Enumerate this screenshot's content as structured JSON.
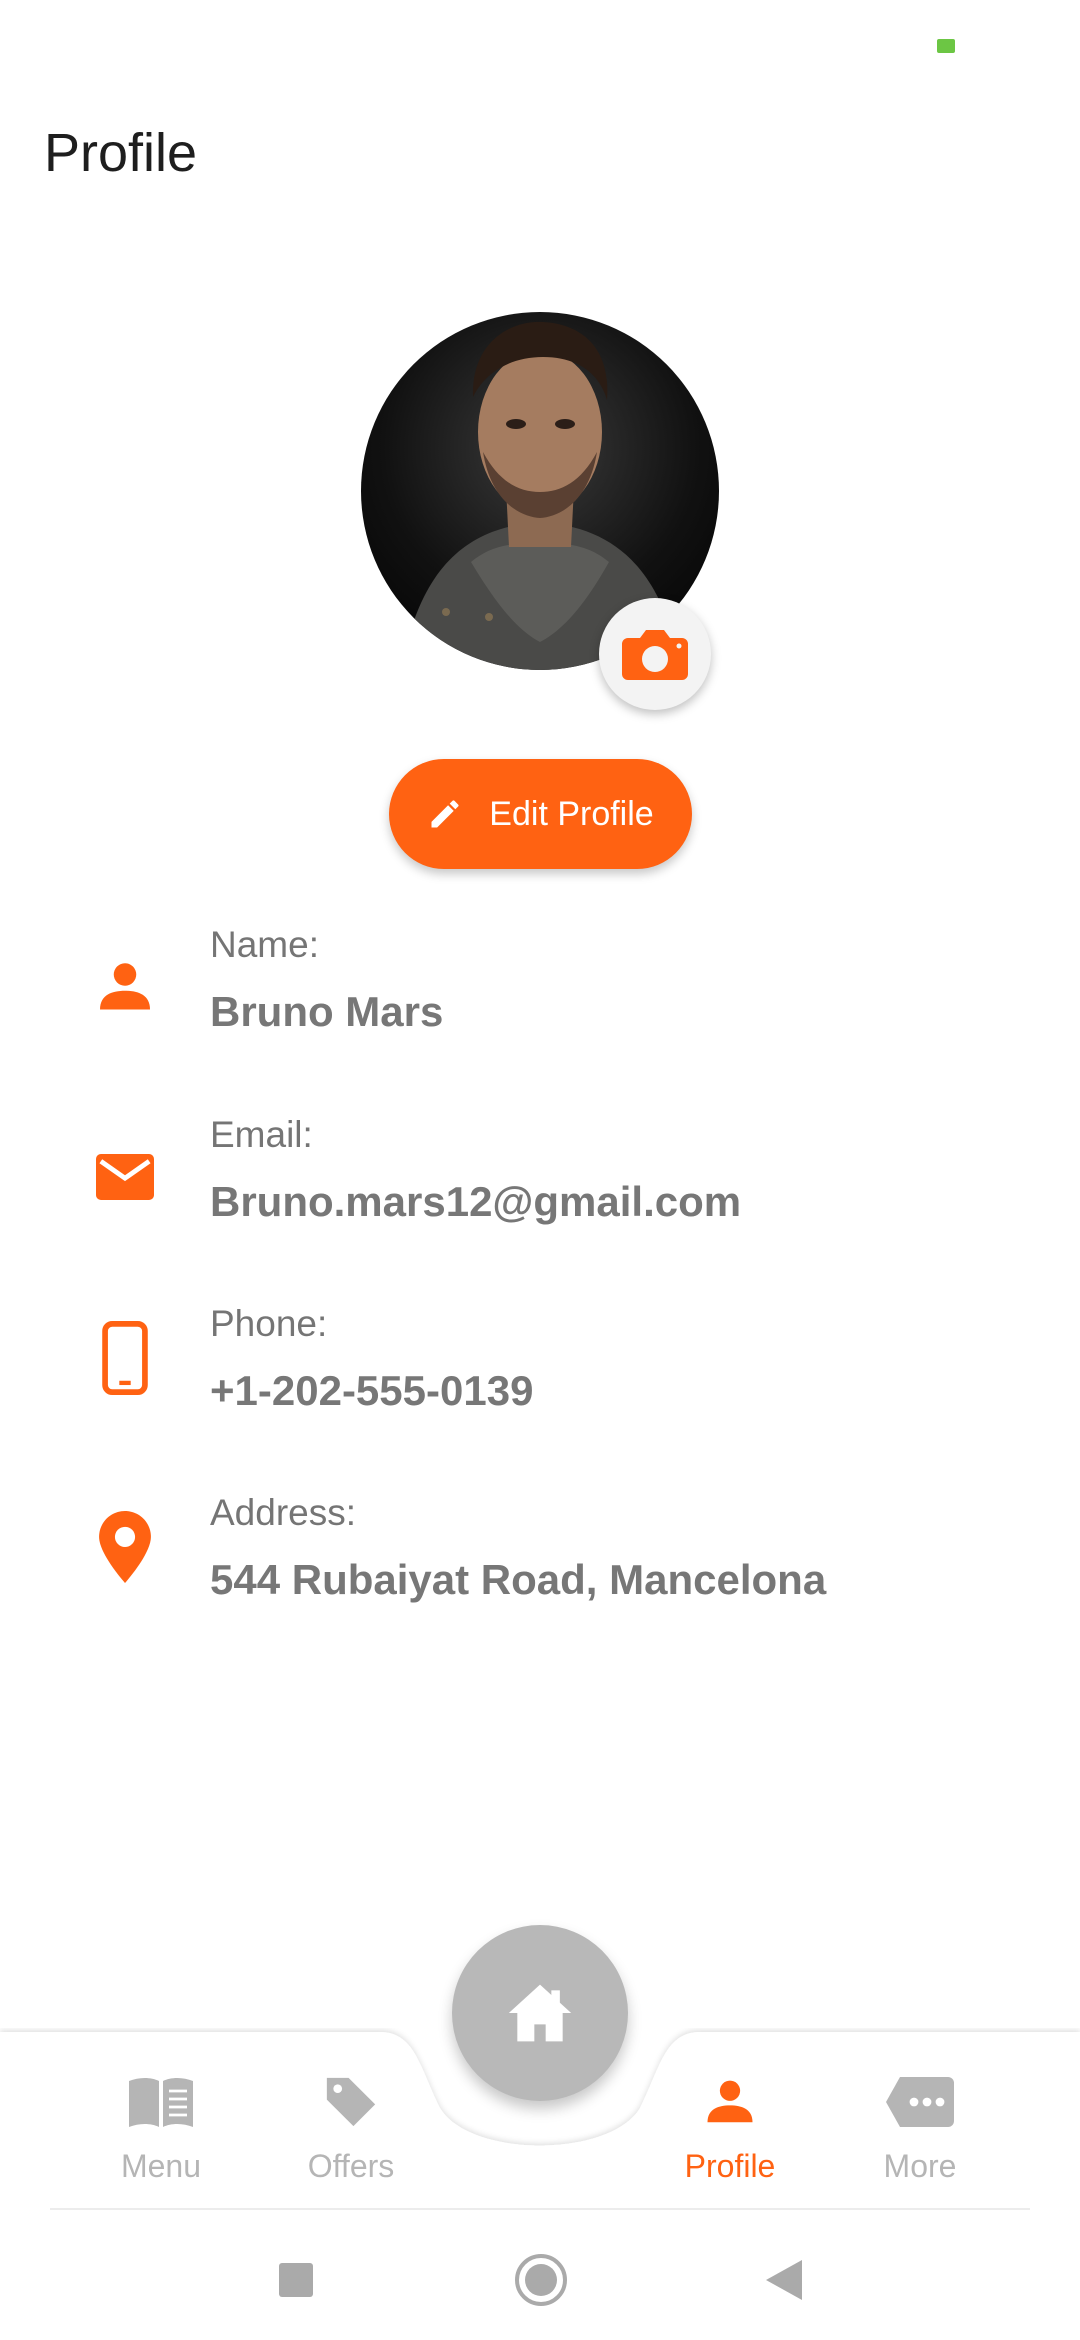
{
  "status_bar": {
    "battery_indicator": "4"
  },
  "page": {
    "title": "Profile"
  },
  "profile": {
    "avatar_alt": "profile photo",
    "edit_button": "Edit Profile"
  },
  "fields": [
    {
      "icon": "person-icon",
      "label": "Name:",
      "value": "Bruno Mars"
    },
    {
      "icon": "mail-icon",
      "label": "Email:",
      "value": "Bruno.mars12@gmail.com"
    },
    {
      "icon": "phone-icon",
      "label": "Phone:",
      "value": "+1-202-555-0139"
    },
    {
      "icon": "location-pin-icon",
      "label": "Address:",
      "value": "544 Rubaiyat Road, Mancelona"
    }
  ],
  "bottom_nav": {
    "items": [
      {
        "label": "Menu",
        "icon": "book-icon",
        "active": false
      },
      {
        "label": "Offers",
        "icon": "tag-icon",
        "active": false
      },
      {
        "label": "Profile",
        "icon": "person-icon",
        "active": true
      },
      {
        "label": "More",
        "icon": "more-dots-icon",
        "active": false
      }
    ],
    "center": {
      "icon": "home-icon"
    }
  },
  "colors": {
    "accent": "#ff6212",
    "inactive": "#b5b5b5",
    "value_text": "#777777"
  }
}
